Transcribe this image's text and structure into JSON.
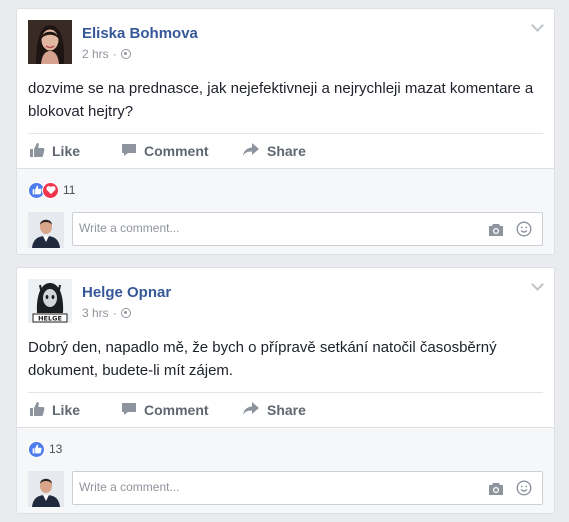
{
  "posts": [
    {
      "author": "Eliska Bohmova",
      "time": "2 hrs",
      "separator": "·",
      "text": "dozvime se na prednasce, jak nejefektivneji a nejrychleji mazat komentare a blokovat hejtry?",
      "actions": {
        "like": "Like",
        "comment": "Comment",
        "share": "Share"
      },
      "reactions": {
        "types": [
          "like",
          "love"
        ],
        "count": "11"
      },
      "comment_placeholder": "Write a comment..."
    },
    {
      "author": "Helge Opnar",
      "time": "3 hrs",
      "separator": "·",
      "text": "Dobrý den, napadlo mě, že bych o přípravě setkání natočil časosběrný dokument, budete-li mít zájem.",
      "actions": {
        "like": "Like",
        "comment": "Comment",
        "share": "Share"
      },
      "reactions": {
        "types": [
          "like"
        ],
        "count": "13"
      },
      "comment_placeholder": "Write a comment...",
      "avatar_text": "HELGE"
    }
  ],
  "colors": {
    "link": "#365899",
    "like": "#4c7ced",
    "love": "#f0364c",
    "background": "#e9ebee"
  },
  "icons": [
    "globe-icon",
    "chevron-down-icon",
    "thumbs-up-icon",
    "comment-icon",
    "share-icon",
    "camera-icon",
    "smiley-icon"
  ]
}
